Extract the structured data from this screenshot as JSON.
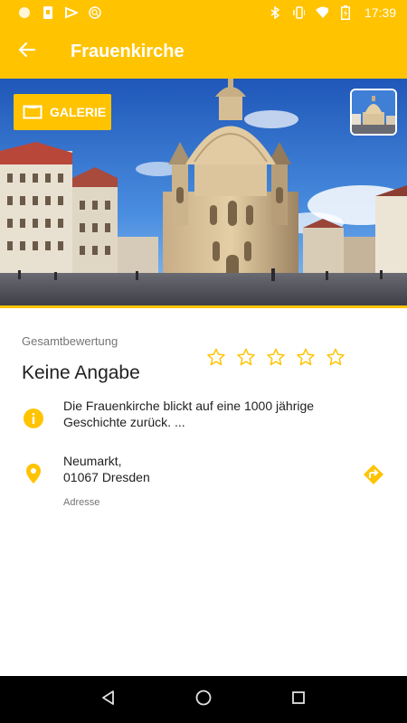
{
  "status_bar": {
    "time": "17:39",
    "left_icons": [
      "notification-dot-icon",
      "sim-icon",
      "media-icon",
      "search-circle-icon"
    ],
    "right_icons": [
      "bluetooth-icon",
      "vibrate-icon",
      "wifi-icon",
      "battery-icon"
    ]
  },
  "toolbar": {
    "title": "Frauenkirche",
    "back_icon": "arrow-left-icon"
  },
  "hero": {
    "gallery_label": "GALERIE",
    "gallery_icon": "gallery-frame-icon"
  },
  "rating": {
    "label": "Gesamtbewertung",
    "value": "Keine Angabe",
    "stars_total": 5,
    "stars_filled": 0
  },
  "info": {
    "icon": "info-icon",
    "text_line1": "Die Frauenkirche blickt auf eine 1000 jährige",
    "text_line2": "Geschichte zurück. ..."
  },
  "address": {
    "icon": "location-pin-icon",
    "line1": "Neumarkt,",
    "line2": "01067 Dresden",
    "caption": "Adresse",
    "directions_icon": "directions-icon"
  },
  "nav": {
    "icons": [
      "back-triangle-icon",
      "home-circle-icon",
      "recents-square-icon"
    ]
  },
  "colors": {
    "accent": "#ffc300",
    "text_primary": "#212121",
    "text_secondary": "#757575",
    "nav_bar": "#000000"
  }
}
